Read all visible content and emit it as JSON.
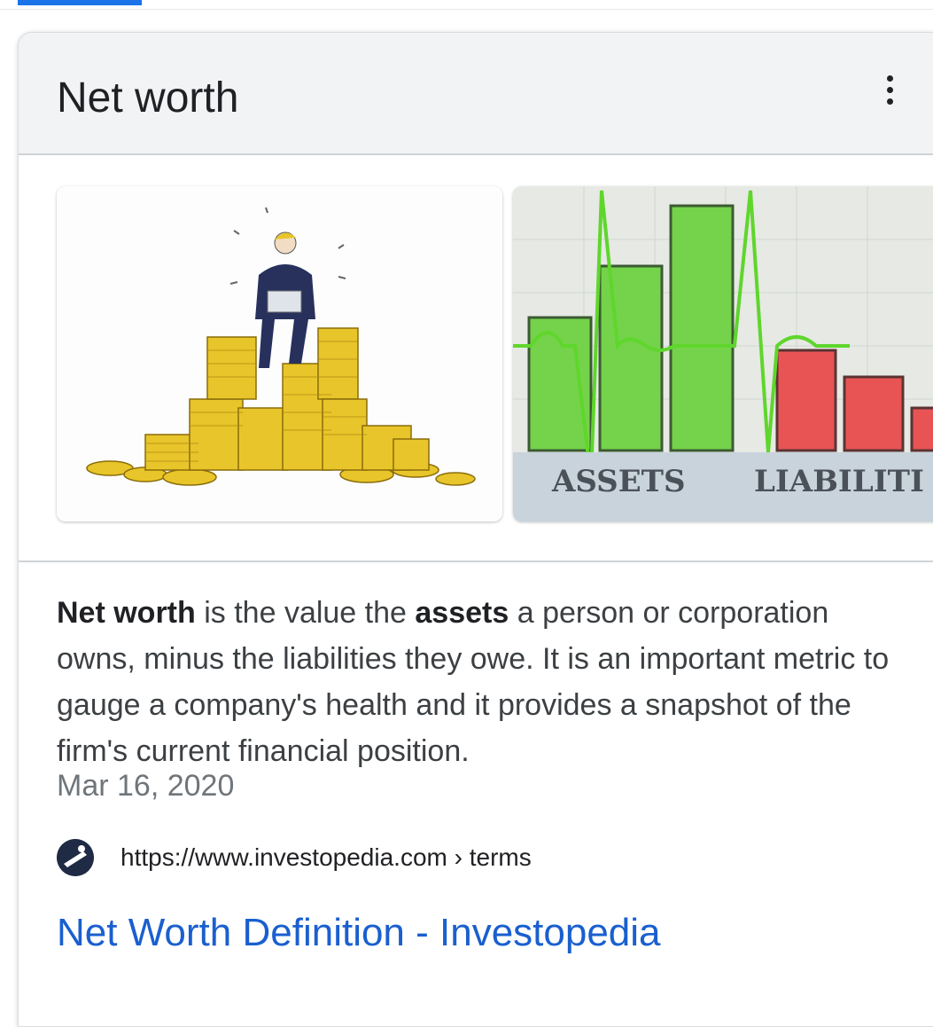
{
  "card": {
    "title": "Net worth"
  },
  "gallery": {
    "image2_labels": [
      "ASSETS",
      "LIABILITI"
    ]
  },
  "snippet": {
    "term": "Net worth",
    "part1": " is the value the ",
    "bold2": "assets",
    "part2": " a person or corporation owns, minus the liabilities they owe. It is an important metric to gauge a company's health and it provides a snapshot of the firm's current financial position.",
    "date": "Mar 16, 2020"
  },
  "source": {
    "url": "https://www.investopedia.com › terms"
  },
  "result": {
    "title": "Net Worth Definition - Investopedia"
  },
  "colors": {
    "accent": "#1a73e8",
    "link": "#1a5fcf",
    "asset_green": "#74d34a",
    "liability_red": "#e85454",
    "coin_gold": "#e8c52a"
  },
  "icons": {
    "more": "more-vert-icon",
    "favicon": "investopedia-logo"
  }
}
